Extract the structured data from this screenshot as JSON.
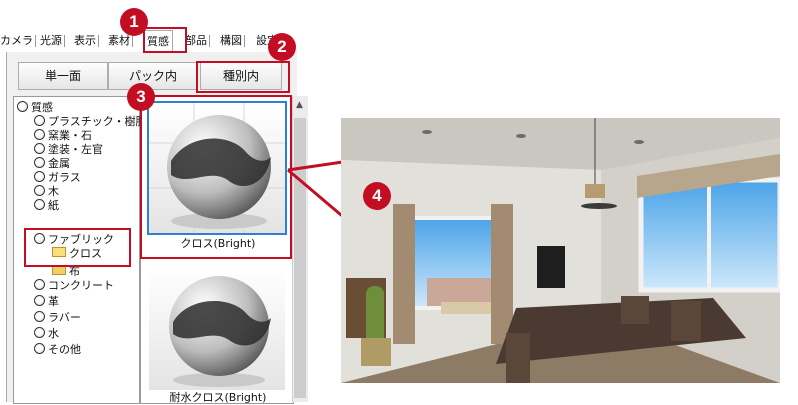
{
  "tabs": [
    "カメラ",
    "光源",
    "表示",
    "素材",
    "質感",
    "部品",
    "構図",
    "設定"
  ],
  "active_tab": "質感",
  "mode_buttons": [
    "単一面",
    "パック内",
    "種別内"
  ],
  "tree": {
    "root": "質感",
    "items": [
      "プラスチック・樹脂",
      "窯業・石",
      "塗装・左官",
      "金属",
      "ガラス",
      "木",
      "紙",
      "ファブリック",
      "クロス",
      "布",
      "コンクリート",
      "革",
      "ラバー",
      "水",
      "その他"
    ]
  },
  "previews": [
    {
      "label": "クロス(Bright)",
      "selected": true
    },
    {
      "label": "耐水クロス(Bright)",
      "selected": false
    }
  ],
  "callouts": [
    "1",
    "2",
    "3",
    "4"
  ],
  "colors": {
    "accent": "#c30d23",
    "selection": "#2f7fd4"
  }
}
